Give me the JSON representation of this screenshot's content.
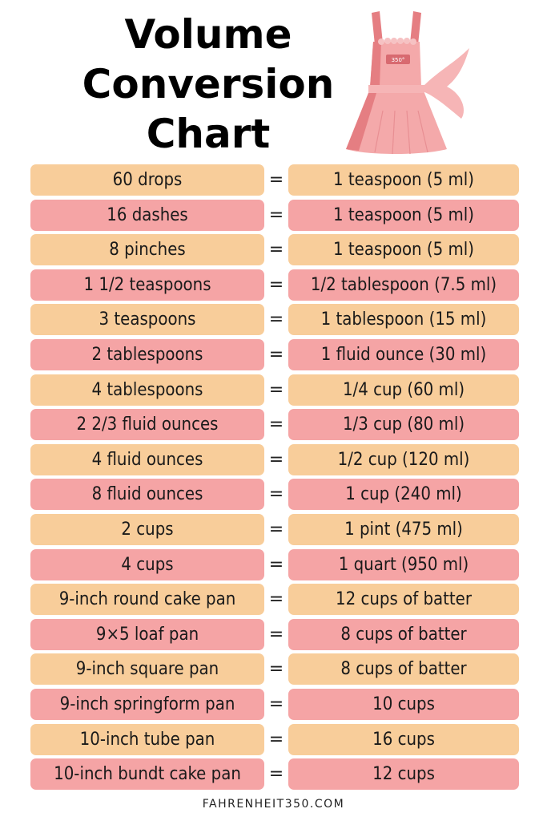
{
  "header": {
    "title_lines": [
      "Volume",
      "Conversion",
      "Chart"
    ]
  },
  "illustration": {
    "name": "apron-illustration",
    "label": "350°",
    "colors": {
      "light": "#f4a9aa",
      "dark": "#e57e82",
      "bow": "#f6b5b6"
    }
  },
  "colors": {
    "peach": "#f8cd9a",
    "pink": "#f5a4a5"
  },
  "equals_sign": "=",
  "conversions": [
    {
      "from": "60 drops",
      "to": "1 teaspoon (5 ml)",
      "color": "peach"
    },
    {
      "from": "16 dashes",
      "to": "1 teaspoon (5 ml)",
      "color": "pink"
    },
    {
      "from": "8 pinches",
      "to": "1 teaspoon (5 ml)",
      "color": "peach"
    },
    {
      "from": "1 1/2 teaspoons",
      "to": "1/2 tablespoon (7.5 ml)",
      "color": "pink"
    },
    {
      "from": "3 teaspoons",
      "to": "1 tablespoon (15 ml)",
      "color": "peach"
    },
    {
      "from": "2 tablespoons",
      "to": "1 fluid ounce (30 ml)",
      "color": "pink"
    },
    {
      "from": "4 tablespoons",
      "to": "1/4 cup (60 ml)",
      "color": "peach"
    },
    {
      "from": "2 2/3 fluid ounces",
      "to": "1/3 cup (80 ml)",
      "color": "pink"
    },
    {
      "from": "4 fluid ounces",
      "to": "1/2 cup (120 ml)",
      "color": "peach"
    },
    {
      "from": "8 fluid ounces",
      "to": "1 cup (240 ml)",
      "color": "pink"
    },
    {
      "from": "2 cups",
      "to": "1 pint (475 ml)",
      "color": "peach"
    },
    {
      "from": "4 cups",
      "to": "1 quart (950 ml)",
      "color": "pink"
    },
    {
      "from": "9-inch round cake pan",
      "to": "12 cups of batter",
      "color": "peach"
    },
    {
      "from": "9×5 loaf pan",
      "to": "8 cups of batter",
      "color": "pink"
    },
    {
      "from": "9-inch square pan",
      "to": "8 cups of batter",
      "color": "peach"
    },
    {
      "from": "9-inch springform pan",
      "to": "10 cups",
      "color": "pink"
    },
    {
      "from": "10-inch tube pan",
      "to": "16 cups",
      "color": "peach"
    },
    {
      "from": "10-inch bundt cake pan",
      "to": "12 cups",
      "color": "pink"
    }
  ],
  "footer": {
    "site": "FAHRENHEIT350.COM"
  }
}
